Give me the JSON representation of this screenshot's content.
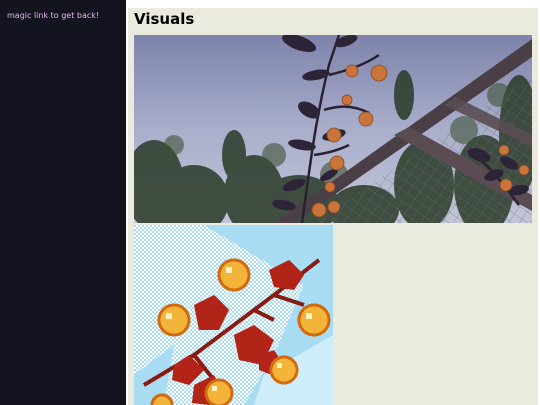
{
  "sidebar": {
    "magic_link": "magic link to get back!"
  },
  "main": {
    "title": "Visuals",
    "images": [
      {
        "name": "barberry-branch-photo",
        "kind": "photograph"
      },
      {
        "name": "barberry-branch-pixel-art",
        "kind": "pixel-art"
      }
    ]
  },
  "colors": {
    "sidebar_bg": "#141420",
    "link": "#e0b8ee",
    "main_bg": "#ebeadf",
    "sky": "#8d94b9",
    "leaf": "#2e2438",
    "flower": "#c8743a",
    "pixel_bg": "#a8dcf2",
    "pixel_leaf": "#b22318",
    "pixel_flower": "#f2b53a"
  }
}
